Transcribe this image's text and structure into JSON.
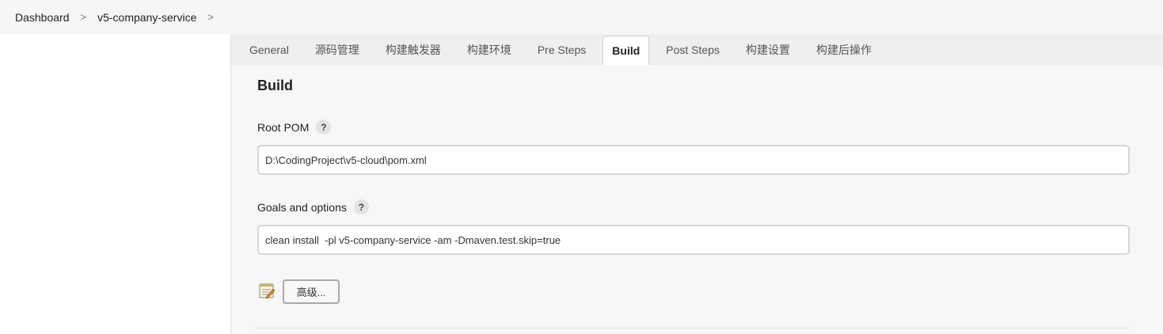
{
  "breadcrumb": {
    "items": [
      "Dashboard",
      "v5-company-service"
    ],
    "separator": ">"
  },
  "tabs": [
    {
      "label": "General"
    },
    {
      "label": "源码管理"
    },
    {
      "label": "构建触发器"
    },
    {
      "label": "构建环境"
    },
    {
      "label": "Pre Steps"
    },
    {
      "label": "Build",
      "active": true
    },
    {
      "label": "Post Steps"
    },
    {
      "label": "构建设置"
    },
    {
      "label": "构建后操作"
    }
  ],
  "build": {
    "title": "Build",
    "root_pom": {
      "label": "Root POM",
      "help": "?",
      "value": "D:\\CodingProject\\v5-cloud\\pom.xml"
    },
    "goals": {
      "label": "Goals and options",
      "help": "?",
      "value": "clean install  -pl v5-company-service -am -Dmaven.test.skip=true"
    },
    "advanced_button": "高级...",
    "notepad_icon": "notepad-icon"
  },
  "colors": {
    "tab_strip": "#efefef",
    "panel_bg": "#f7f7f7",
    "breadcrumb_bg": "#f6f6f6"
  }
}
